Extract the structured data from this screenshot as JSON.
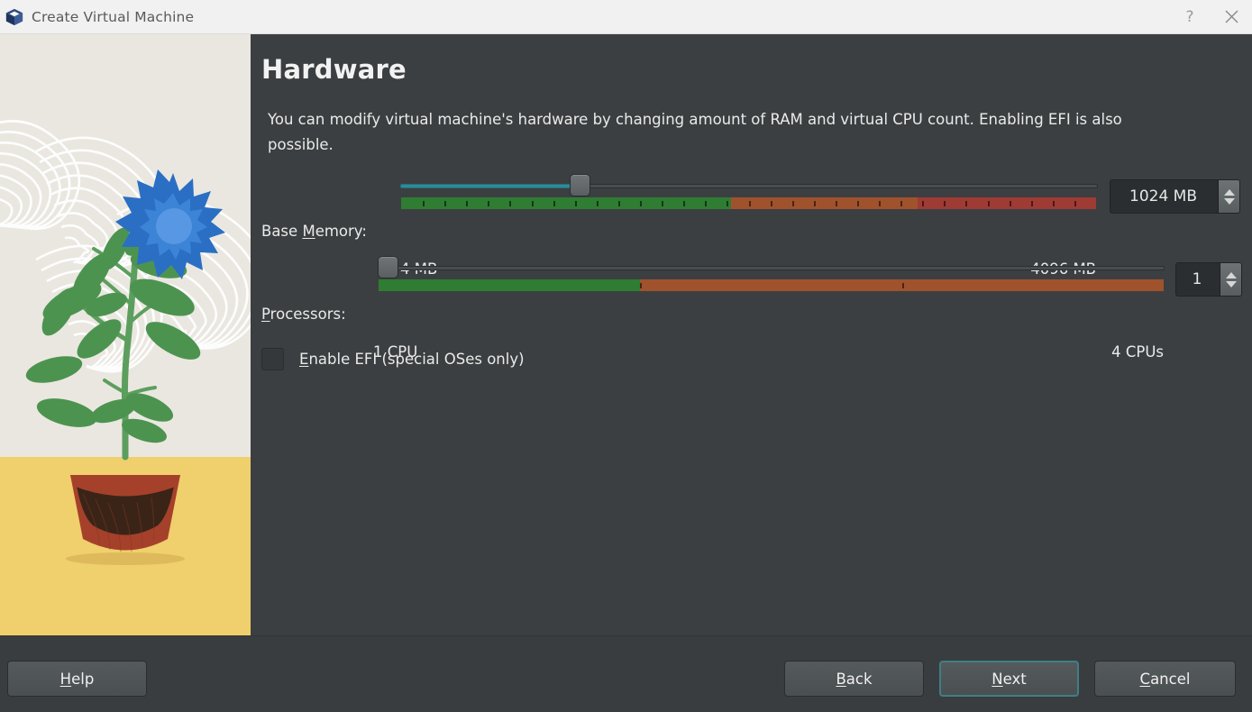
{
  "window": {
    "title": "Create Virtual Machine",
    "app_icon": "virtualbox-cube-icon",
    "help_button": "?",
    "close_button": "✕"
  },
  "page": {
    "title": "Hardware",
    "description": "You can modify virtual machine's hardware by changing amount of RAM and virtual CPU count. Enabling EFI is also possible."
  },
  "base_memory": {
    "label_prefix": "Base ",
    "label_mnemonic": "M",
    "label_suffix": "emory:",
    "slider_percent": 25,
    "min_label": "4 MB",
    "max_label": "4096 MB",
    "value": "1024 MB",
    "min_mb": 4,
    "max_mb": 4096,
    "current_mb": 1024,
    "scale": {
      "green_percent": 47.5,
      "orange_percent": 26.8,
      "red_percent": 25.7,
      "green_color": "#2e7d32",
      "orange_color": "#a0522d",
      "red_color": "#9e3b34"
    }
  },
  "processors": {
    "label_mnemonic": "P",
    "label_suffix": "rocessors:",
    "slider_percent": 0,
    "min_label": "1 CPU",
    "max_label": "4 CPUs",
    "value": "1",
    "min_cpus": 1,
    "max_cpus": 4,
    "current_cpus": 1,
    "scale": {
      "green_percent": 33.3,
      "orange_percent": 66.7,
      "green_color": "#2e7d32",
      "orange_color": "#a0522d"
    }
  },
  "efi": {
    "checked": false,
    "label_mnemonic": "E",
    "label_suffix": "nable EFI (special OSes only)"
  },
  "footer": {
    "help": {
      "mnemonic": "H",
      "rest": "elp"
    },
    "back": {
      "mnemonic": "B",
      "rest": "ack"
    },
    "next": {
      "mnemonic": "N",
      "rest": "ext"
    },
    "cancel": {
      "mnemonic": "C",
      "rest": "ancel"
    }
  },
  "illustration": {
    "name": "potted-plant-with-blue-flower",
    "sky_color": "#eae7e0",
    "ground_color": "#f0cf6d",
    "leaf_color": "#4d9350",
    "flower_color": "#2a6fc4",
    "pot_color": "#a5412a",
    "soil_color": "#3a2418"
  },
  "colors": {
    "window_bg": "#3c3f41",
    "titlebar_bg": "#f1f1f1",
    "accent": "#2f8a96",
    "focus_border": "#3f7f86"
  }
}
